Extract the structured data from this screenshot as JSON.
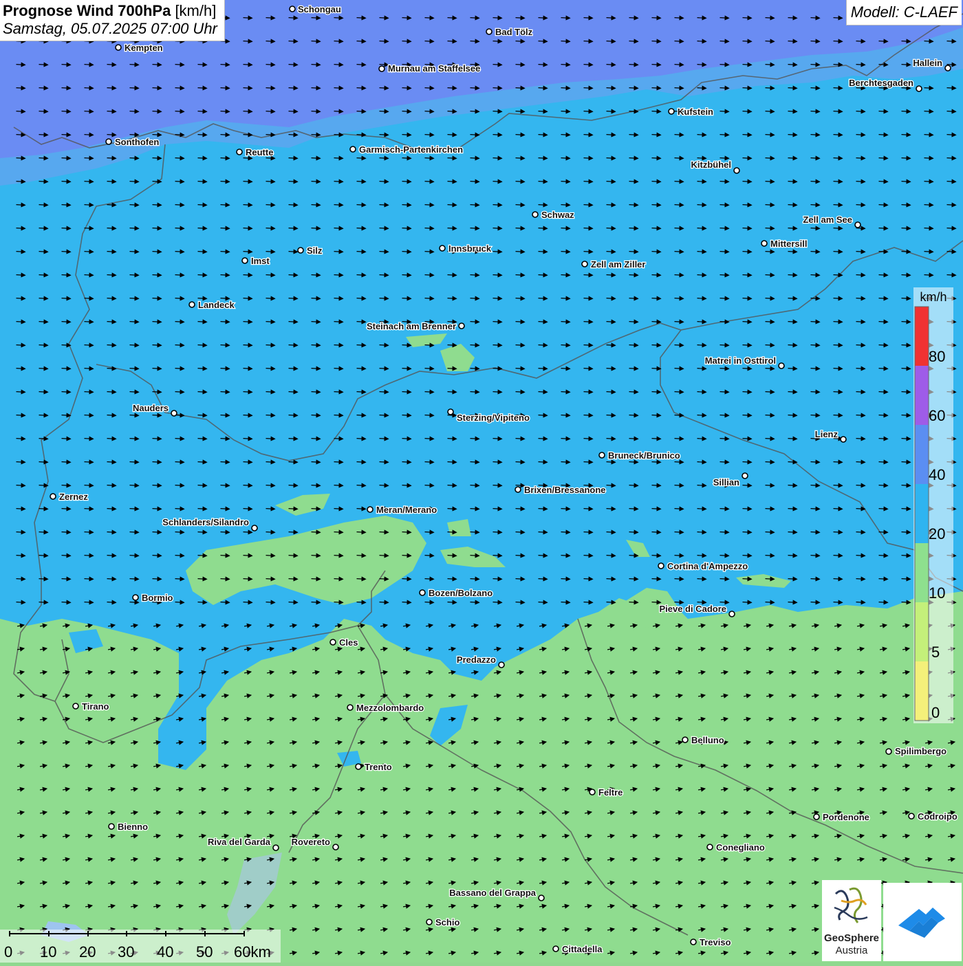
{
  "header": {
    "title": "Prognose Wind 700hPa",
    "unit": "[km/h]",
    "datetime": "Samstag, 05.07.2025 07:00 Uhr",
    "model": "Modell: C-LAEF"
  },
  "legend": {
    "unit": "km/h",
    "labels": [
      "80",
      "60",
      "40",
      "20",
      "10",
      "5",
      "0"
    ],
    "colors": [
      "#f03232",
      "#9e5ce8",
      "#5b8ef2",
      "#2fb4f0",
      "#8ee08e",
      "#c4f07a",
      "#f4f07a"
    ]
  },
  "places": [
    {
      "name": "Schongau"
    },
    {
      "name": "Bad Tölz"
    },
    {
      "name": "Kempten"
    },
    {
      "name": "Murnau am Staffelsee"
    },
    {
      "name": "Hallein"
    },
    {
      "name": "Berchtesgaden"
    },
    {
      "name": "Kufstein"
    },
    {
      "name": "Sonthofen"
    },
    {
      "name": "Reutte"
    },
    {
      "name": "Garmisch-Partenkirchen"
    },
    {
      "name": "Kitzbühel"
    },
    {
      "name": "Schwaz"
    },
    {
      "name": "Zell am See"
    },
    {
      "name": "Mittersill"
    },
    {
      "name": "Innsbruck"
    },
    {
      "name": "Silz"
    },
    {
      "name": "Imst"
    },
    {
      "name": "Zell am Ziller"
    },
    {
      "name": "Landeck"
    },
    {
      "name": "Steinach am Brenner"
    },
    {
      "name": "Matrei in Osttirol"
    },
    {
      "name": "Nauders"
    },
    {
      "name": "Sterzing/Vipiteno"
    },
    {
      "name": "Lienz"
    },
    {
      "name": "Bruneck/Brunico"
    },
    {
      "name": "Sillian"
    },
    {
      "name": "Zernez"
    },
    {
      "name": "Brixen/Bressanone"
    },
    {
      "name": "Meran/Merano"
    },
    {
      "name": "Schlanders/Silandro"
    },
    {
      "name": "Cortina d'Ampezzo"
    },
    {
      "name": "Bozen/Bolzano"
    },
    {
      "name": "Bormio"
    },
    {
      "name": "Pieve di Cadore"
    },
    {
      "name": "Cles"
    },
    {
      "name": "Predazzo"
    },
    {
      "name": "Tirano"
    },
    {
      "name": "Mezzolombardo"
    },
    {
      "name": "Belluno"
    },
    {
      "name": "Spilimbergo"
    },
    {
      "name": "Trento"
    },
    {
      "name": "Feltre"
    },
    {
      "name": "Bienno"
    },
    {
      "name": "Pordenone"
    },
    {
      "name": "Codroipo"
    },
    {
      "name": "Riva del Garda"
    },
    {
      "name": "Rovereto"
    },
    {
      "name": "Conegliano"
    },
    {
      "name": "Bassano del Grappa"
    },
    {
      "name": "Schio"
    },
    {
      "name": "Treviso"
    },
    {
      "name": "Cittadella"
    }
  ],
  "scalebar": {
    "labels": [
      "0",
      "10",
      "20",
      "30",
      "40",
      "50",
      "60km"
    ]
  },
  "logos": {
    "geosphere_name": "GeoSphere",
    "geosphere_sub": "Austria"
  }
}
